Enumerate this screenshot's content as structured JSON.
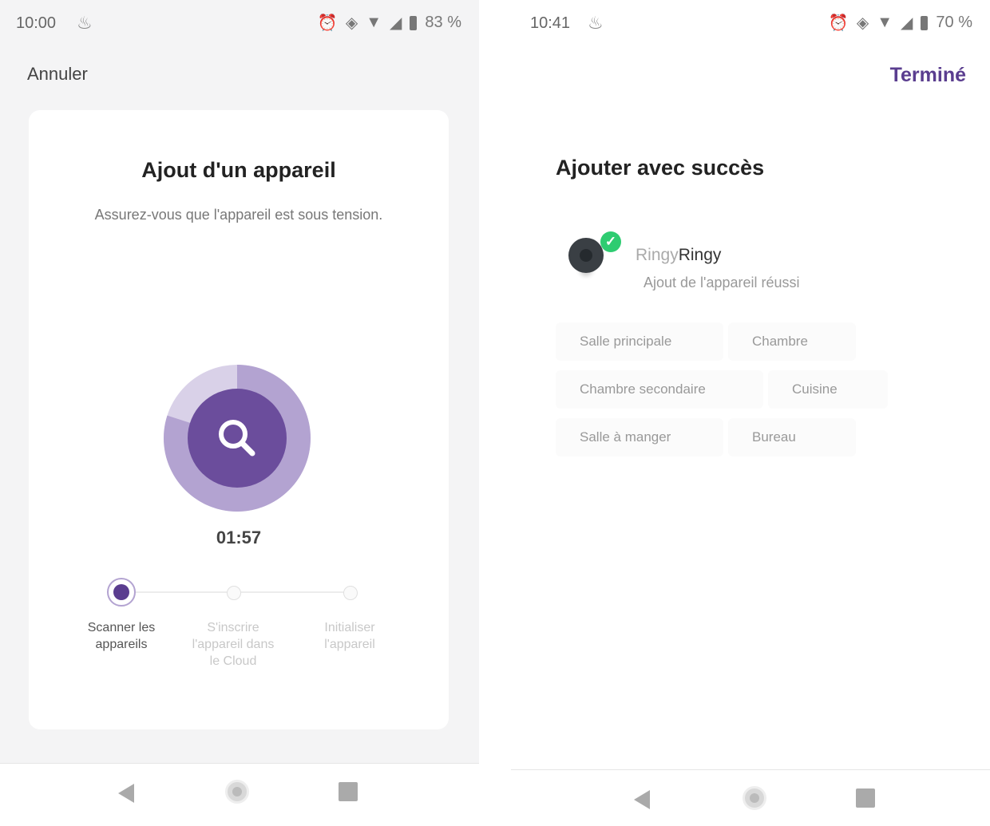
{
  "left": {
    "status": {
      "time": "10:00",
      "battery": "83 %"
    },
    "cancel_label": "Annuler",
    "title": "Ajout d'un appareil",
    "subtitle": "Assurez-vous que l'appareil est sous tension.",
    "timer": "01:57",
    "progress": 0.8,
    "steps": [
      {
        "label": "Scanner les appareils",
        "state": "active"
      },
      {
        "label": "S'inscrire l'appareil dans le Cloud",
        "state": "pending"
      },
      {
        "label": "Initialiser l'appareil",
        "state": "pending"
      }
    ]
  },
  "right": {
    "status": {
      "time": "10:41",
      "battery": "70 %"
    },
    "done_label": "Terminé",
    "title": "Ajouter avec succès",
    "device": {
      "name_ghost": "Ringy",
      "name": "Ringy",
      "status": "Ajout de l'appareil réussi"
    },
    "rooms": [
      "Salle principale",
      "Chambre",
      "Chambre secondaire",
      "Cuisine",
      "Salle à manger",
      "Bureau"
    ]
  },
  "colors": {
    "accent": "#5a3d8f",
    "scanner_outer": "#b3a3d1",
    "scanner_inner": "#6b4d9c",
    "success": "#2ecc71"
  }
}
